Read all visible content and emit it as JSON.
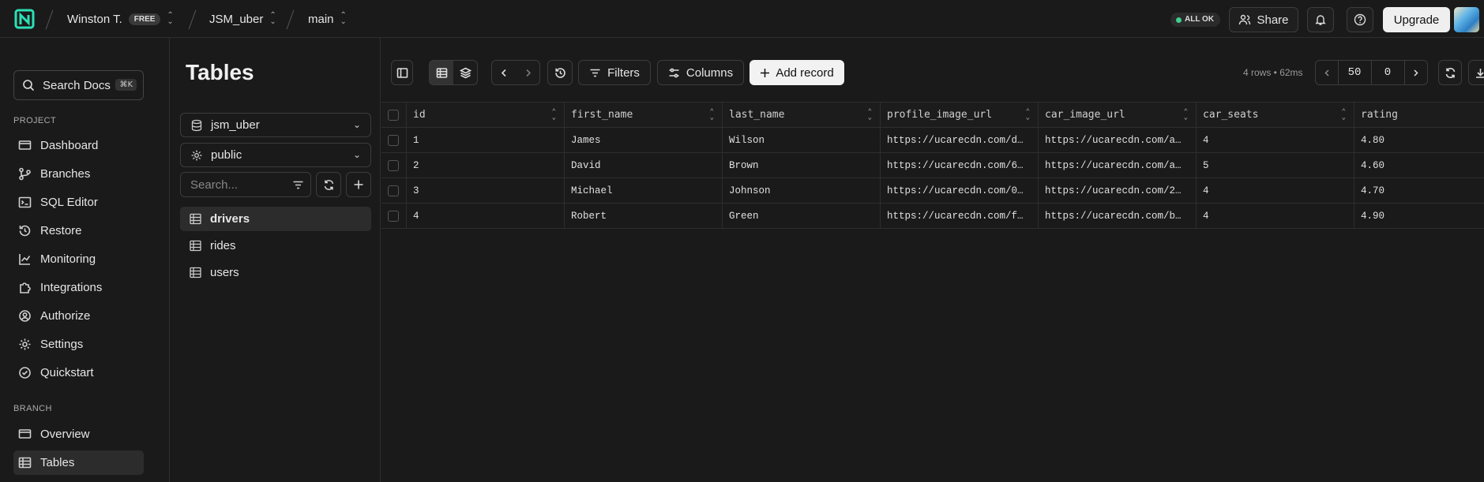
{
  "header": {
    "org": "Winston T.",
    "plan_badge": "FREE",
    "project": "JSM_uber",
    "branch": "main",
    "status": "ALL OK",
    "share_label": "Share",
    "upgrade_label": "Upgrade"
  },
  "sidebar": {
    "search_label": "Search Docs",
    "search_shortcut": "⌘K",
    "project_section": "PROJECT",
    "project_items": [
      {
        "label": "Dashboard",
        "icon": "dashboard-icon"
      },
      {
        "label": "Branches",
        "icon": "branch-icon"
      },
      {
        "label": "SQL Editor",
        "icon": "sql-icon"
      },
      {
        "label": "Restore",
        "icon": "restore-icon"
      },
      {
        "label": "Monitoring",
        "icon": "chart-icon"
      },
      {
        "label": "Integrations",
        "icon": "puzzle-icon"
      },
      {
        "label": "Authorize",
        "icon": "authorize-icon"
      },
      {
        "label": "Settings",
        "icon": "gear-icon"
      },
      {
        "label": "Quickstart",
        "icon": "check-circle-icon"
      }
    ],
    "branch_section": "BRANCH",
    "branch_items": [
      {
        "label": "Overview",
        "icon": "overview-icon"
      },
      {
        "label": "Tables",
        "icon": "table-icon",
        "active": true
      }
    ]
  },
  "tables_panel": {
    "title": "Tables",
    "database": "jsm_uber",
    "schema": "public",
    "search_placeholder": "Search...",
    "tables": [
      "drivers",
      "rides",
      "users"
    ],
    "active_table": "drivers"
  },
  "toolbar": {
    "filters_label": "Filters",
    "columns_label": "Columns",
    "add_record_label": "Add record",
    "rows_info": "4 rows • 62ms",
    "page_size": "50",
    "offset": "0"
  },
  "grid": {
    "columns": [
      "id",
      "first_name",
      "last_name",
      "profile_image_url",
      "car_image_url",
      "car_seats",
      "rating"
    ],
    "rows": [
      [
        "1",
        "James",
        "Wilson",
        "https://ucarecdn.com/d…",
        "https://ucarecdn.com/a…",
        "4",
        "4.80"
      ],
      [
        "2",
        "David",
        "Brown",
        "https://ucarecdn.com/6…",
        "https://ucarecdn.com/a…",
        "5",
        "4.60"
      ],
      [
        "3",
        "Michael",
        "Johnson",
        "https://ucarecdn.com/0…",
        "https://ucarecdn.com/2…",
        "4",
        "4.70"
      ],
      [
        "4",
        "Robert",
        "Green",
        "https://ucarecdn.com/f…",
        "https://ucarecdn.com/b…",
        "4",
        "4.90"
      ]
    ]
  },
  "colors": {
    "background": "#1a1a1a",
    "status_green": "#3ecf8e",
    "logo": "#2de0b6"
  }
}
